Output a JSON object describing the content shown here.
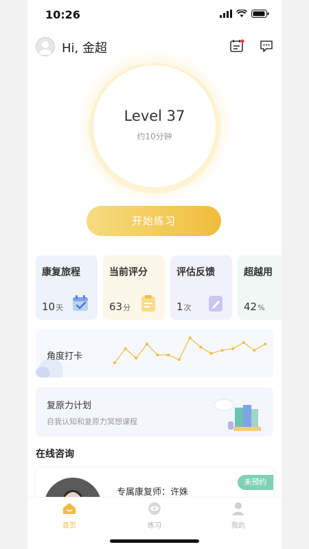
{
  "status_bar": {
    "time": "10:26"
  },
  "header": {
    "greeting": "Hi, 金超"
  },
  "level": {
    "title": "Level 37",
    "duration": "约10分钟"
  },
  "start_button": {
    "label": "开始练习"
  },
  "stat_cards": [
    {
      "title": "康复旅程",
      "value": "10",
      "unit": "天",
      "icon": "calendar-check-icon",
      "bg": "#eef2fb"
    },
    {
      "title": "当前评分",
      "value": "63",
      "unit": "分",
      "icon": "clipboard-icon",
      "bg": "#fdf7e9"
    },
    {
      "title": "评估反馈",
      "value": "1",
      "unit": "次",
      "icon": "edit-note-icon",
      "bg": "#f1f1fb"
    },
    {
      "title": "超越用",
      "value": "42",
      "unit": "%",
      "icon": "",
      "bg": "#f0f8f5"
    }
  ],
  "angle_card": {
    "label": "角度打卡",
    "chart_data": {
      "type": "line",
      "values": [
        5,
        14,
        8,
        17,
        10,
        10,
        7,
        21,
        15,
        11,
        13,
        14,
        18,
        13,
        17
      ],
      "color": "#f0bd3c"
    }
  },
  "plan_card": {
    "title": "复原力计划",
    "subtitle": "自我认知和复原力冥想课程"
  },
  "consult": {
    "heading": "在线咨询",
    "doctor_label": "专属康复师：许姝",
    "badge": "未预约"
  },
  "tabs": [
    {
      "label": "首页",
      "icon": "home-icon",
      "active": true
    },
    {
      "label": "练习",
      "icon": "eye-icon",
      "active": false
    },
    {
      "label": "我的",
      "icon": "user-icon",
      "active": false
    }
  ],
  "colors": {
    "accent": "#f0bd3c",
    "badge": "#7fd1b4"
  }
}
